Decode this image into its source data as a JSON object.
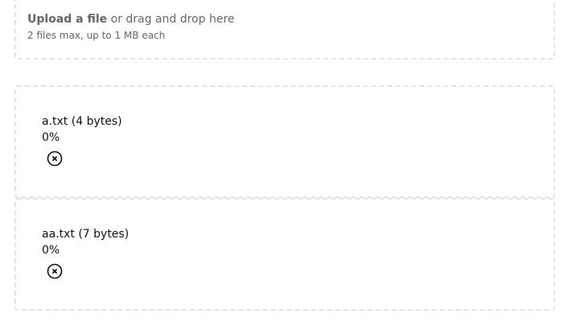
{
  "dropzone": {
    "upload_label": "Upload a file",
    "drag_text": " or drag and drop here",
    "hint": "2 files max, up to 1 MB each"
  },
  "files": [
    {
      "name_label": "a.txt (4 bytes)",
      "progress": "0%",
      "remove_icon": "cancel-icon"
    },
    {
      "name_label": "aa.txt (7 bytes)",
      "progress": "0%",
      "remove_icon": "cancel-icon"
    }
  ],
  "colors": {
    "border": "#e3e3e3",
    "muted_text": "#666666",
    "text": "#111111"
  }
}
